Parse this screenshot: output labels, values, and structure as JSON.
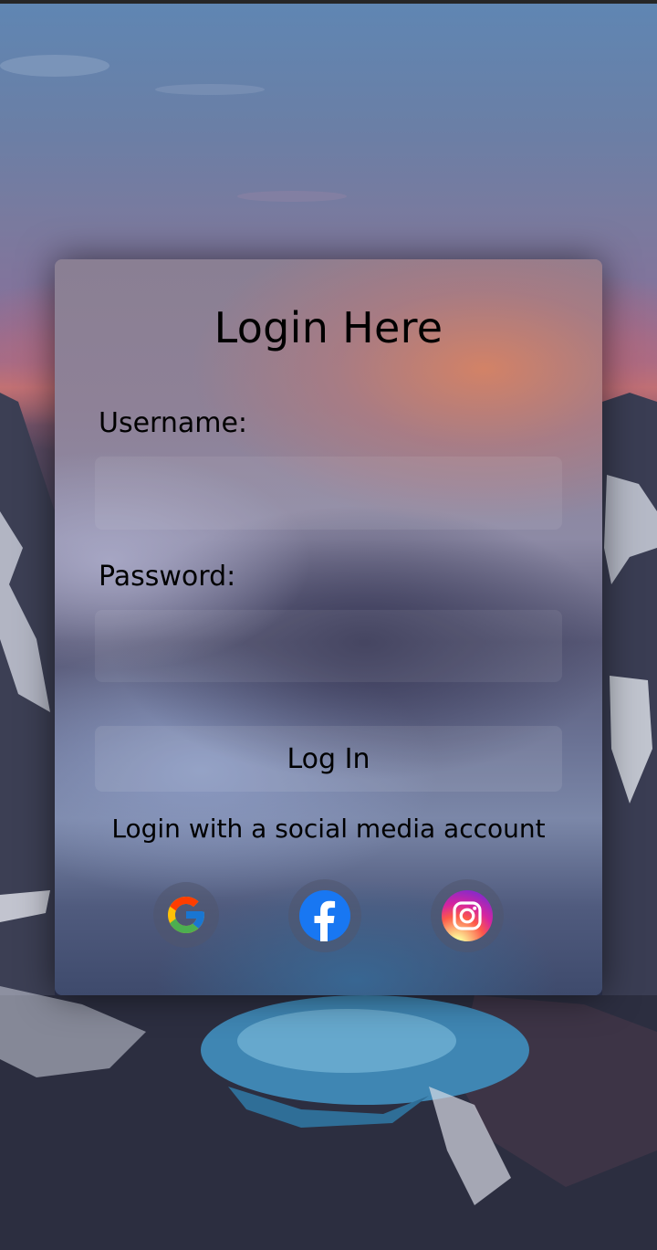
{
  "login": {
    "title": "Login Here",
    "username_label": "Username:",
    "username_value": "",
    "password_label": "Password:",
    "password_value": "",
    "submit_label": "Log In",
    "social_text": "Login with a social media account"
  },
  "social_buttons": [
    {
      "icon": "google-icon",
      "brand": "Google"
    },
    {
      "icon": "facebook-icon",
      "brand": "Facebook",
      "color": "#1877f2"
    },
    {
      "icon": "instagram-icon",
      "brand": "Instagram"
    }
  ]
}
